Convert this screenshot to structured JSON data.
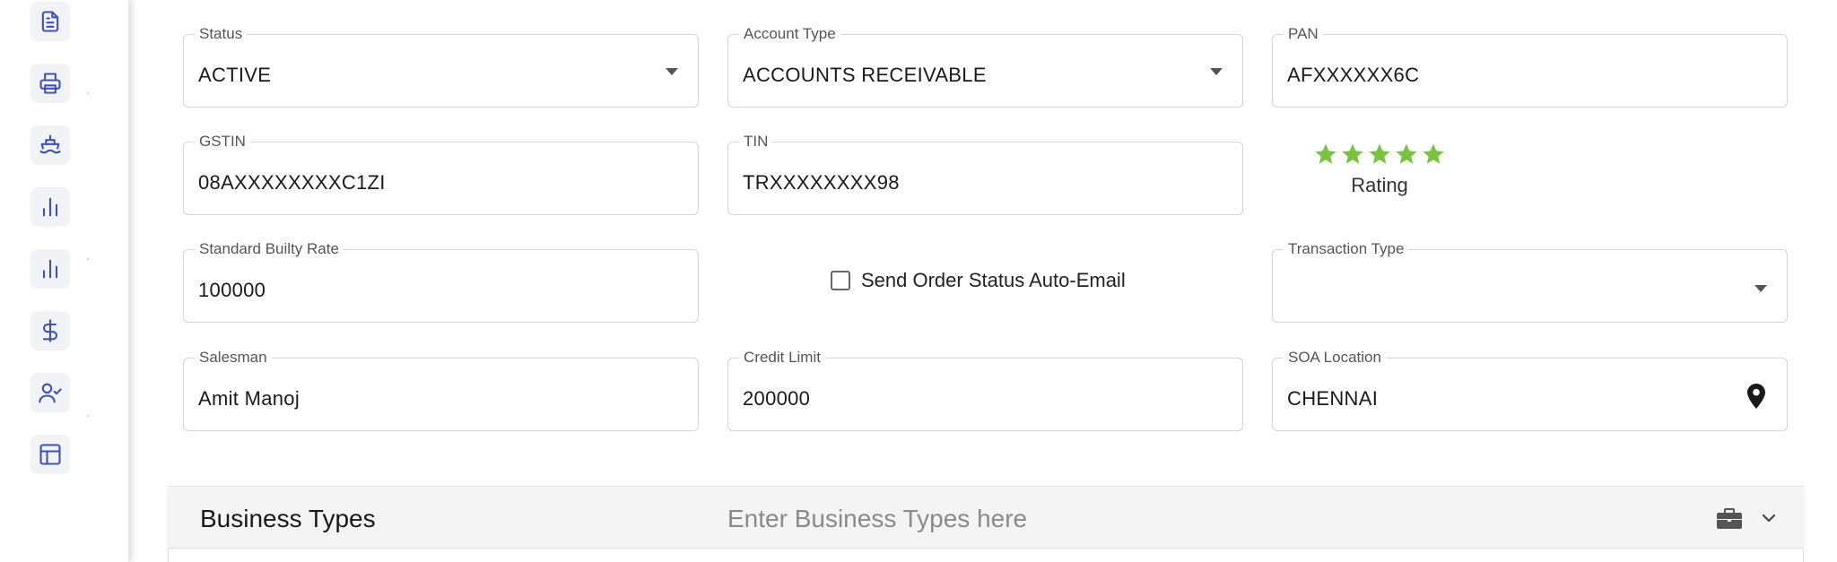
{
  "sidebar": {
    "items": [
      {
        "icon": "document-icon"
      },
      {
        "icon": "printer-icon"
      },
      {
        "icon": "ship-icon"
      },
      {
        "icon": "bar-chart-icon"
      },
      {
        "icon": "bar-chart-icon"
      },
      {
        "icon": "dollar-icon"
      },
      {
        "icon": "user-check-icon"
      },
      {
        "icon": "layout-icon"
      }
    ],
    "accent": "#3f51b5"
  },
  "form": {
    "status": {
      "label": "Status",
      "value": "ACTIVE"
    },
    "account_type": {
      "label": "Account Type",
      "value": "ACCOUNTS RECEIVABLE"
    },
    "pan": {
      "label": "PAN",
      "value": "AFXXXXXX6C"
    },
    "gstin": {
      "label": "GSTIN",
      "value": "08AXXXXXXXXC1ZI"
    },
    "tin": {
      "label": "TIN",
      "value": "TRXXXXXXXX98"
    },
    "rating": {
      "label": "Rating",
      "stars": 5,
      "max": 5,
      "color": "#7cc242"
    },
    "standard_builty_rate": {
      "label": "Standard Builty Rate",
      "value": "100000"
    },
    "send_auto_email": {
      "label": "Send Order Status Auto-Email",
      "checked": false
    },
    "transaction_type": {
      "label": "Transaction Type",
      "value": ""
    },
    "salesman": {
      "label": "Salesman",
      "value": "Amit Manoj"
    },
    "credit_limit": {
      "label": "Credit Limit",
      "value": "200000"
    },
    "soa_location": {
      "label": "SOA Location",
      "value": "CHENNAI"
    }
  },
  "business_types": {
    "title": "Business Types",
    "placeholder": "Enter Business Types here",
    "icon": "briefcase-icon",
    "toggle_icon": "chevron-down-icon"
  }
}
